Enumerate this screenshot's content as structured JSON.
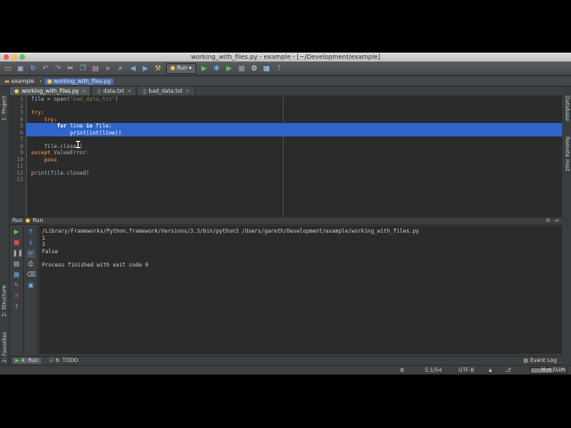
{
  "window": {
    "title": "working_with_files.py - example - [~/Development/example]"
  },
  "toolbar": {
    "icons": [
      "folder-open-icon",
      "save-icon",
      "sync-icon",
      "undo-icon",
      "redo-icon",
      "cut-icon",
      "copy-icon",
      "paste-icon",
      "find-icon",
      "replace-icon",
      "back-icon",
      "forward-icon",
      "build-icon"
    ],
    "run_config_label": "Run",
    "actions": [
      "run-icon",
      "debug-icon",
      "coverage-icon",
      "stop-icon",
      "settings-icon",
      "structure-icon",
      "help-icon"
    ]
  },
  "navbar": {
    "crumbs": [
      "example",
      "working_with_files.py"
    ]
  },
  "left_tool_tabs": [
    "1: Project",
    "2: Structure",
    "2: Favorites"
  ],
  "right_tool_tabs": [
    "Database",
    "Remote Host"
  ],
  "tabs": [
    {
      "label": "working_with_files.py",
      "active": true
    },
    {
      "label": "data.txt",
      "active": false
    },
    {
      "label": "bad_data.txt",
      "active": false
    }
  ],
  "editor": {
    "line_numbers": [
      "1",
      "2",
      "3",
      "4",
      "5",
      "6",
      "7",
      "8",
      "9",
      "10",
      "11",
      "12",
      "13"
    ]
  },
  "run_panel": {
    "title": "Run",
    "config": "Run",
    "output": [
      "/Library/Frameworks/Python.framework/Versions/3.3/bin/python3 /Users/gareth/Development/example/working_with_files.py",
      "1",
      "2",
      "False",
      "",
      "Process finished with exit code 0"
    ]
  },
  "bottom_tabs": {
    "run": "4: Run",
    "todo": "6: TODO",
    "event_log": "Event Log"
  },
  "status": {
    "position": "5:1/54",
    "encoding": "UTF-8",
    "memory": "M of 711M",
    "memory_fraction": 0.6
  },
  "colors": {
    "selection": "#2f65ca",
    "keyword": "#cc7832",
    "string": "#6a8759",
    "editor_bg": "#2b2b2b",
    "ide_bg": "#3c3f41"
  }
}
